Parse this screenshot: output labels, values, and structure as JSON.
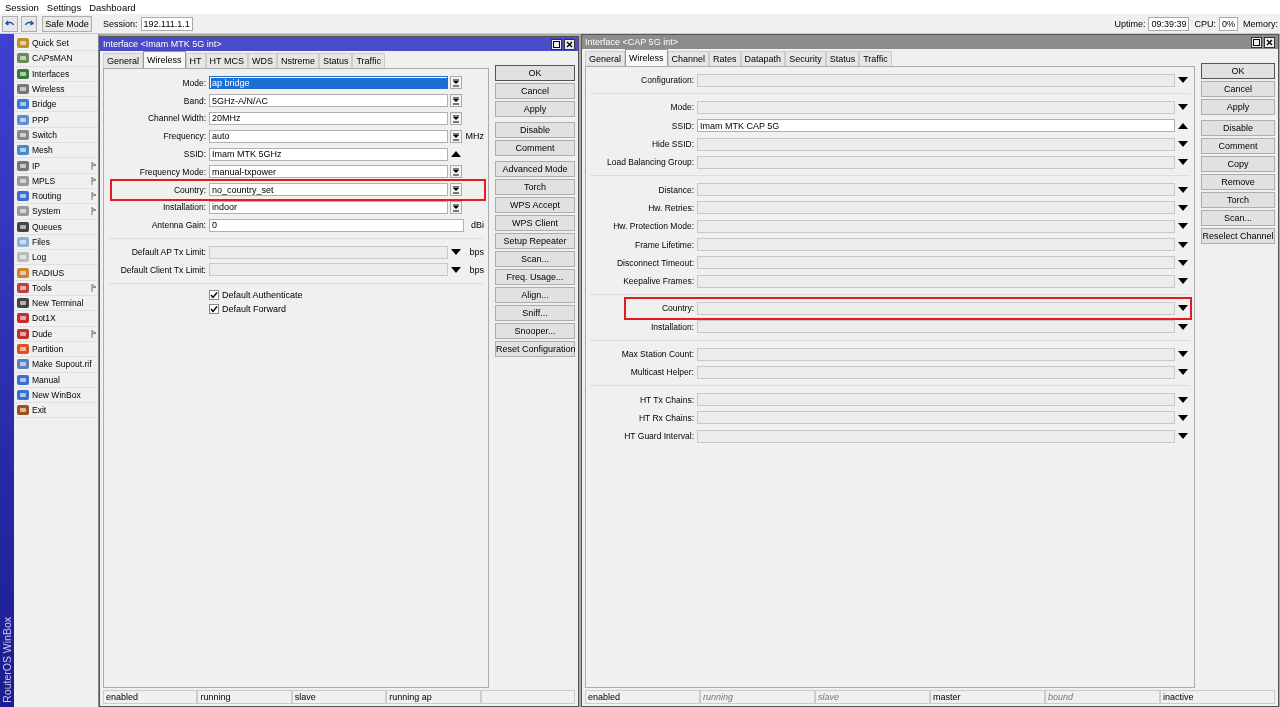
{
  "menubar": [
    "Session",
    "Settings",
    "Dashboard"
  ],
  "toolbar": {
    "safe_mode": "Safe Mode",
    "session_label": "Session:",
    "session_value": "192.111.1.1",
    "uptime_label": "Uptime:",
    "uptime_value": "09:39:39",
    "cpu_label": "CPU:",
    "cpu_value": "0%",
    "memory_label": "Memory:"
  },
  "brand": "RouterOS WinBox",
  "sidebar": {
    "items": [
      {
        "label": "Quick Set",
        "has_submenu": false
      },
      {
        "label": "CAPsMAN",
        "has_submenu": false
      },
      {
        "label": "Interfaces",
        "has_submenu": false
      },
      {
        "label": "Wireless",
        "has_submenu": false
      },
      {
        "label": "Bridge",
        "has_submenu": false
      },
      {
        "label": "PPP",
        "has_submenu": false
      },
      {
        "label": "Switch",
        "has_submenu": false
      },
      {
        "label": "Mesh",
        "has_submenu": false
      },
      {
        "label": "IP",
        "has_submenu": true
      },
      {
        "label": "MPLS",
        "has_submenu": true
      },
      {
        "label": "Routing",
        "has_submenu": true
      },
      {
        "label": "System",
        "has_submenu": true
      },
      {
        "label": "Queues",
        "has_submenu": false
      },
      {
        "label": "Files",
        "has_submenu": false
      },
      {
        "label": "Log",
        "has_submenu": false
      },
      {
        "label": "RADIUS",
        "has_submenu": false
      },
      {
        "label": "Tools",
        "has_submenu": true
      },
      {
        "label": "New Terminal",
        "has_submenu": false
      },
      {
        "label": "Dot1X",
        "has_submenu": false
      },
      {
        "label": "Dude",
        "has_submenu": true
      },
      {
        "label": "Partition",
        "has_submenu": false
      },
      {
        "label": "Make Supout.rif",
        "has_submenu": false
      },
      {
        "label": "Manual",
        "has_submenu": false
      },
      {
        "label": "New WinBox",
        "has_submenu": false
      },
      {
        "label": "Exit",
        "has_submenu": false
      }
    ]
  },
  "windows": [
    {
      "title": "Interface <Imam MTK 5G int>",
      "active": true,
      "tabs": [
        {
          "label": "General",
          "selected": false
        },
        {
          "label": "Wireless",
          "selected": true
        },
        {
          "label": "HT",
          "selected": false
        },
        {
          "label": "HT MCS",
          "selected": false
        },
        {
          "label": "WDS",
          "selected": false
        },
        {
          "label": "Nstreme",
          "selected": false
        },
        {
          "label": "Status",
          "selected": false
        },
        {
          "label": "Traffic",
          "selected": false
        }
      ],
      "field_groups": [
        [
          {
            "label": "Mode:",
            "value": "ap bridge",
            "kind": "drop",
            "disabled": false,
            "outlined": false,
            "text_selected": true
          },
          {
            "label": "Band:",
            "value": "5GHz-A/N/AC",
            "kind": "drop",
            "disabled": false,
            "outlined": false,
            "text_selected": false
          },
          {
            "label": "Channel Width:",
            "value": "20MHz",
            "kind": "drop",
            "disabled": false,
            "outlined": false,
            "text_selected": false
          },
          {
            "label": "Frequency:",
            "value": "auto",
            "kind": "drop",
            "unit": "MHz",
            "disabled": false,
            "outlined": false,
            "text_selected": false
          },
          {
            "label": "SSID:",
            "value": "Imam MTK 5GHz",
            "kind": "up",
            "disabled": false,
            "outlined": false,
            "text_selected": false
          },
          {
            "label": "Frequency Mode:",
            "value": "manual-txpower",
            "kind": "drop",
            "disabled": false,
            "outlined": false,
            "text_selected": false
          },
          {
            "label": "Country:",
            "value": "no_country_set",
            "kind": "drop",
            "disabled": false,
            "outlined": true,
            "text_selected": false
          },
          {
            "label": "Installation:",
            "value": "indoor",
            "kind": "drop",
            "disabled": false,
            "outlined": false,
            "text_selected": false
          },
          {
            "label": "Antenna Gain:",
            "value": "0",
            "kind": "plain",
            "unit": "dBi",
            "disabled": false,
            "outlined": false,
            "text_selected": false
          }
        ],
        [
          {
            "label": "Default AP Tx Limit:",
            "kind": "down",
            "unit": "bps",
            "disabled": true,
            "outlined": false
          },
          {
            "label": "Default Client Tx Limit:",
            "kind": "down",
            "unit": "bps",
            "disabled": true,
            "outlined": false
          }
        ]
      ],
      "checkboxes": [
        {
          "label": "Default Authenticate",
          "checked": true
        },
        {
          "label": "Default Forward",
          "checked": true
        }
      ],
      "button_groups": [
        [
          "OK",
          "Cancel",
          "Apply"
        ],
        [
          "Disable",
          "Comment"
        ],
        [
          "Advanced Mode",
          "Torch",
          "WPS Accept",
          "WPS Client",
          "Setup Repeater",
          "Scan...",
          "Freq. Usage...",
          "Align...",
          "Sniff...",
          "Snooper...",
          "Reset Configuration"
        ]
      ],
      "status_bar": [
        {
          "text": "enabled",
          "active": true
        },
        {
          "text": "running",
          "active": true
        },
        {
          "text": "slave",
          "active": true
        },
        {
          "text": "running ap",
          "active": true
        }
      ]
    },
    {
      "title": "Interface <CAP 5G int>",
      "active": false,
      "tabs": [
        {
          "label": "General",
          "selected": false
        },
        {
          "label": "Wireless",
          "selected": true
        },
        {
          "label": "Channel",
          "selected": false
        },
        {
          "label": "Rates",
          "selected": false
        },
        {
          "label": "Datapath",
          "selected": false
        },
        {
          "label": "Security",
          "selected": false
        },
        {
          "label": "Status",
          "selected": false
        },
        {
          "label": "Traffic",
          "selected": false
        }
      ],
      "field_groups": [
        [
          {
            "label": "Configuration:",
            "kind": "down",
            "disabled": true,
            "outlined": false
          }
        ],
        [
          {
            "label": "Mode:",
            "kind": "down",
            "disabled": true,
            "outlined": false
          },
          {
            "label": "SSID:",
            "value": "Imam MTK CAP 5G",
            "kind": "up",
            "disabled": false,
            "outlined": false,
            "text_selected": false
          },
          {
            "label": "Hide SSID:",
            "kind": "down",
            "disabled": true,
            "outlined": false
          },
          {
            "label": "Load Balancing Group:",
            "kind": "down",
            "disabled": true,
            "outlined": false
          }
        ],
        [
          {
            "label": "Distance:",
            "kind": "down",
            "disabled": true,
            "outlined": false
          },
          {
            "label": "Hw. Retries:",
            "kind": "down",
            "disabled": true,
            "outlined": false
          },
          {
            "label": "Hw. Protection Mode:",
            "kind": "down",
            "disabled": true,
            "outlined": false
          },
          {
            "label": "Frame Lifetime:",
            "kind": "down",
            "disabled": true,
            "outlined": false
          },
          {
            "label": "Disconnect Timeout:",
            "kind": "down",
            "disabled": true,
            "outlined": false
          },
          {
            "label": "Keepalive Frames:",
            "kind": "down",
            "disabled": true,
            "outlined": false
          }
        ],
        [
          {
            "label": "Country:",
            "kind": "down",
            "disabled": true,
            "outlined": true
          },
          {
            "label": "Installation:",
            "kind": "down",
            "disabled": true,
            "outlined": false
          }
        ],
        [
          {
            "label": "Max Station Count:",
            "kind": "down",
            "disabled": true,
            "outlined": false
          },
          {
            "label": "Multicast Helper:",
            "kind": "down",
            "disabled": true,
            "outlined": false
          }
        ],
        [
          {
            "label": "HT Tx Chains:",
            "kind": "down",
            "disabled": true,
            "outlined": false
          },
          {
            "label": "HT Rx Chains:",
            "kind": "down",
            "disabled": true,
            "outlined": false
          },
          {
            "label": "HT Guard Interval:",
            "kind": "down",
            "disabled": true,
            "outlined": false
          }
        ]
      ],
      "button_groups": [
        [
          "OK",
          "Cancel",
          "Apply"
        ],
        [
          "Disable",
          "Comment",
          "Copy",
          "Remove",
          "Torch",
          "Scan...",
          "Reselect Channel"
        ]
      ],
      "status_bar": [
        {
          "text": "enabled",
          "active": true
        },
        {
          "text": "running",
          "active": false
        },
        {
          "text": "slave",
          "active": false
        },
        {
          "text": "master",
          "active": true
        },
        {
          "text": "bound",
          "active": false
        },
        {
          "text": "inactive",
          "active": true
        }
      ]
    }
  ]
}
